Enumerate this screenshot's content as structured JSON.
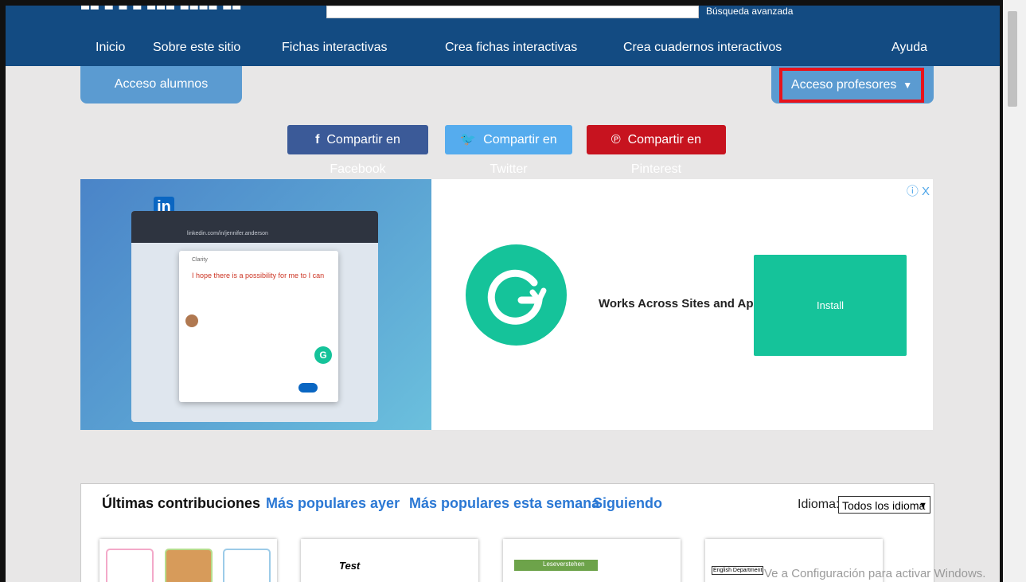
{
  "header": {
    "advanced_search": "Búsqueda avanzada",
    "nav": [
      "Inicio",
      "Sobre este sitio",
      "Fichas interactivas",
      "Crea fichas interactivas",
      "Crea cuadernos interactivos",
      "Ayuda"
    ]
  },
  "access": {
    "students": "Acceso alumnos",
    "teachers": "Acceso profesores"
  },
  "share": {
    "facebook": "Compartir en Facebook",
    "twitter": "Compartir en Twitter",
    "pinterest": "Compartir en Pinterest"
  },
  "ad": {
    "headline": "Works Across Sites and Apps",
    "install": "Install",
    "close": "ⓘ X",
    "linkedin_url": "linkedin.com/in/jennifer.anderson",
    "clarity_label": "Clarity",
    "suggestion": "I hope there is a possibility for me to I can"
  },
  "contributions": {
    "tabs": [
      "Últimas contribuciones",
      "Más populares ayer",
      "Más populares esta semana",
      "Siguiendo"
    ],
    "language_label": "Idioma:",
    "language_value": "Todos los idioma",
    "thumbs": [
      "Test",
      "Leseverstehen",
      "English Department"
    ]
  },
  "watermark": "Ve a Configuración para activar Windows.",
  "colors": {
    "header": "#134b82",
    "accent": "#5b9bd1",
    "highlight": "#e8131b",
    "grammarly": "#15c39a"
  }
}
